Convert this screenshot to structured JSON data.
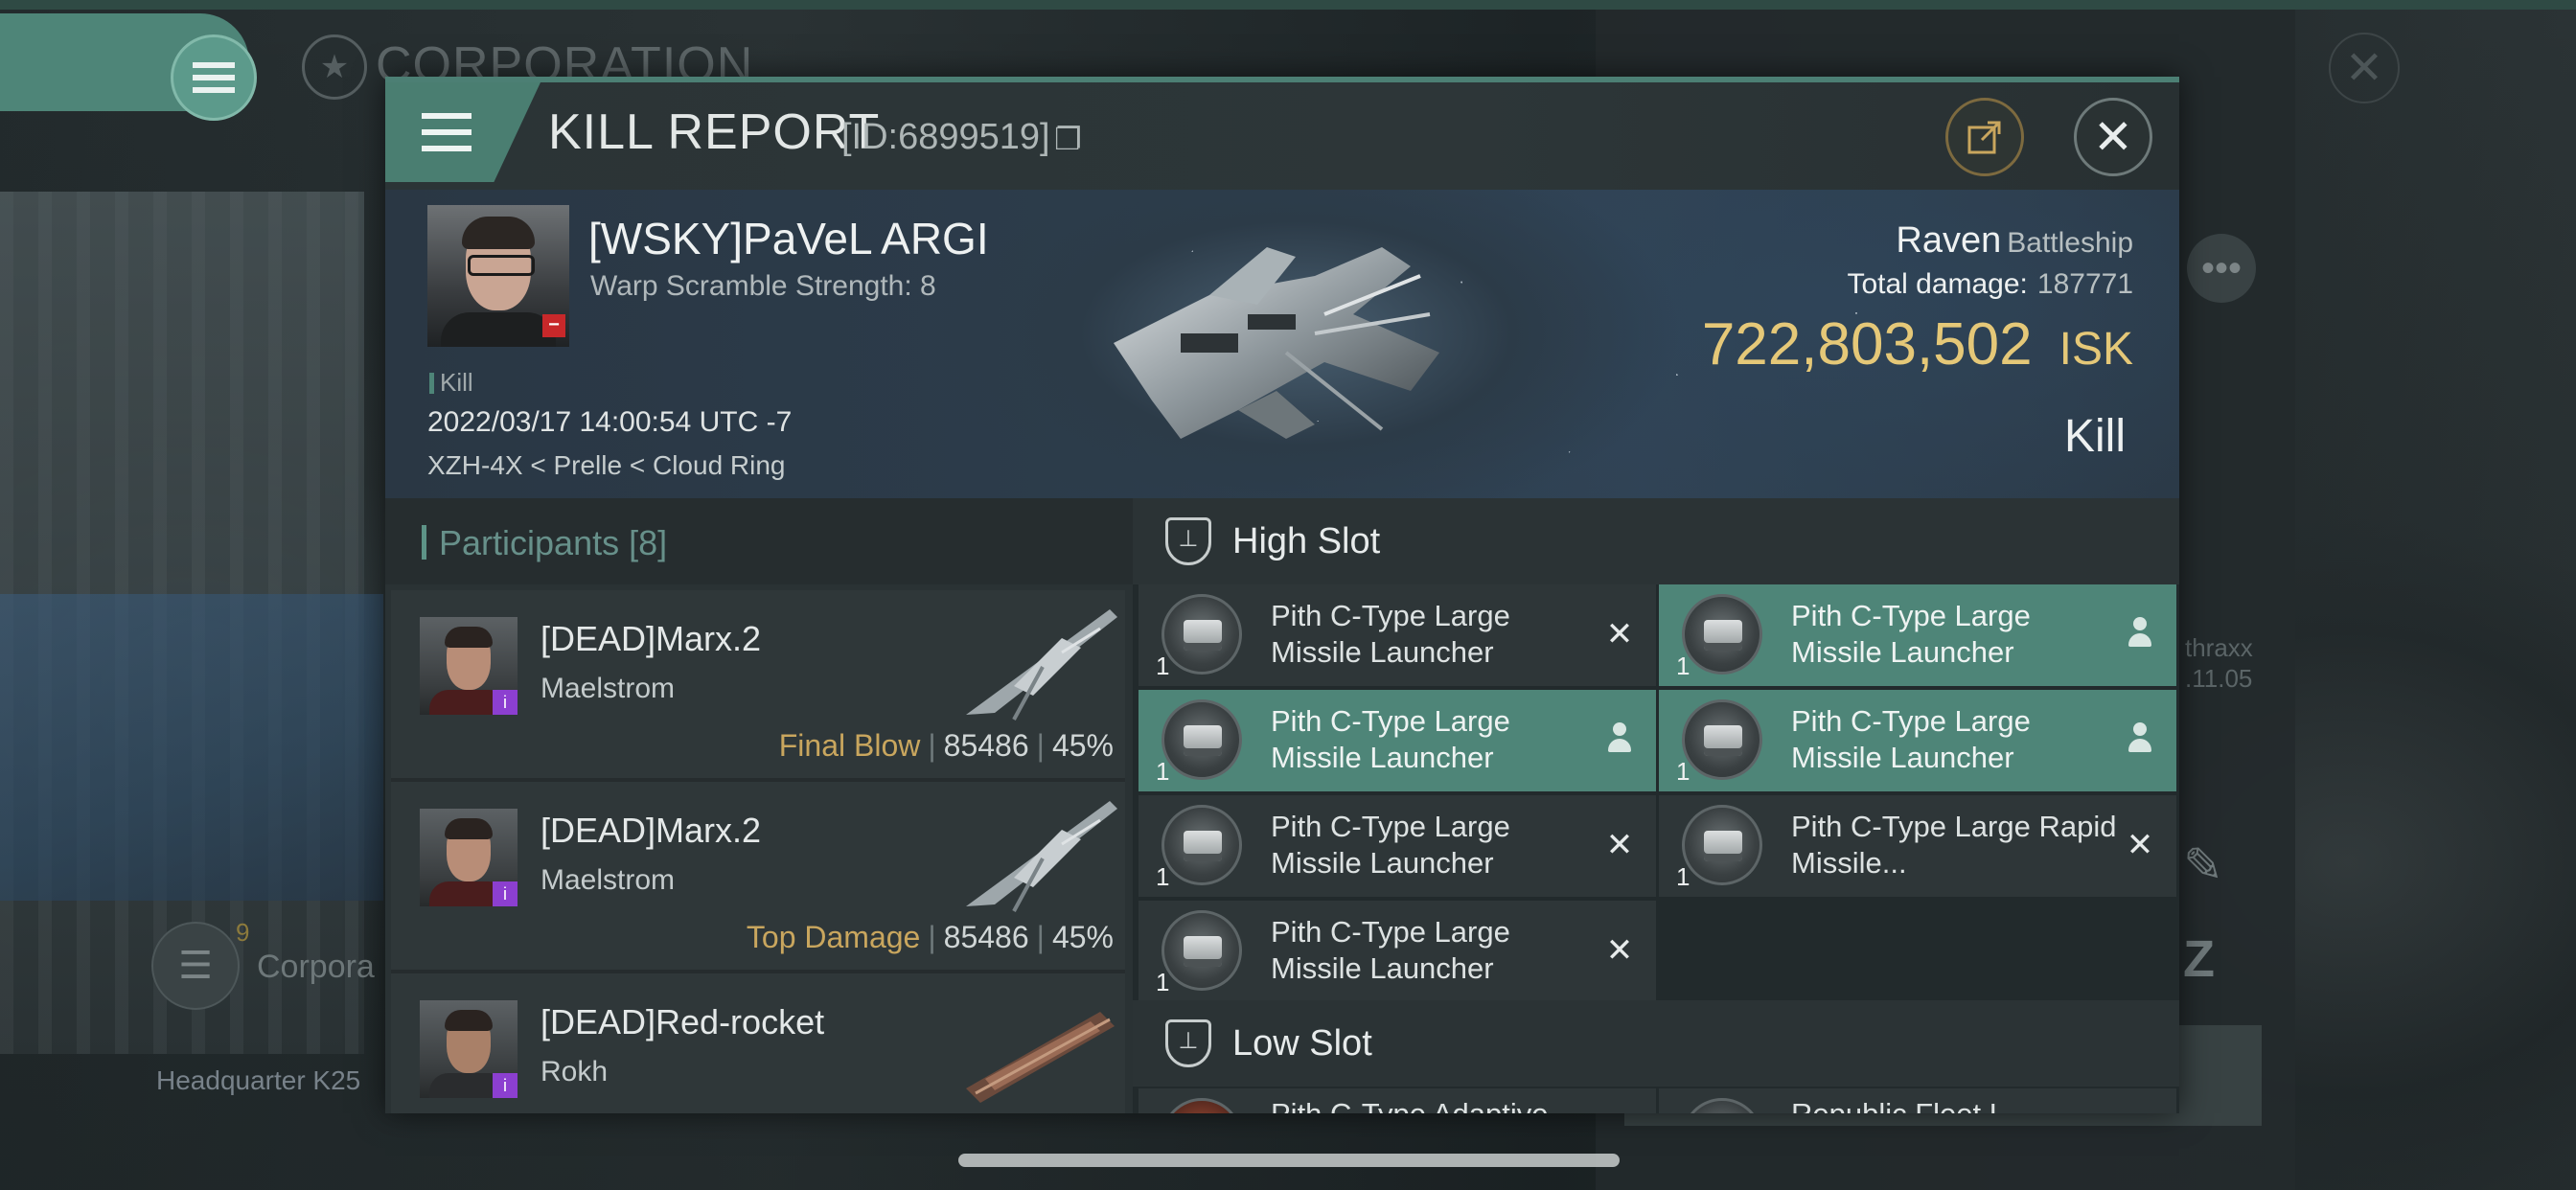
{
  "background": {
    "window_title": "CORPORATION",
    "corporation_label": "Corpora",
    "corporation_badge": "9",
    "headquarter_label": "Headquarter K25",
    "side_text_line1": "thraxx",
    "side_text_line2": ".11.05"
  },
  "dialog": {
    "title": "KILL REPORT",
    "id_label": "[ID:6899519]"
  },
  "victim": {
    "name": "[WSKY]PaVeL ARGI",
    "warp_scramble": "Warp Scramble Strength: 8",
    "tag": "Kill",
    "datetime": "2022/03/17 14:00:54 UTC -7",
    "location": "XZH-4X < Prelle < Cloud Ring",
    "ship_name": "Raven",
    "ship_class": "Battleship",
    "total_damage_label": "Total damage:",
    "total_damage_value": "187771",
    "isk_value": "722,803,502",
    "isk_unit": "ISK",
    "result": "Kill"
  },
  "participants": {
    "title": "Participants",
    "count": "[8]",
    "rows": [
      {
        "name": "[DEAD]Marx.2",
        "ship": "Maelstrom",
        "label": "Final Blow",
        "damage": "85486",
        "percent": "45%"
      },
      {
        "name": "[DEAD]Marx.2",
        "ship": "Maelstrom",
        "label": "Top Damage",
        "damage": "85486",
        "percent": "45%"
      },
      {
        "name": "[DEAD]Red-rocket",
        "ship": "Rokh",
        "label": "",
        "damage": "",
        "percent": ""
      }
    ]
  },
  "fitting": {
    "high_slot_title": "High Slot",
    "low_slot_title": "Low Slot",
    "modules": [
      {
        "qty": "1",
        "name": "Pith C-Type Large Missile Launcher",
        "status": "destroyed"
      },
      {
        "qty": "1",
        "name": "Pith C-Type Large Missile Launcher",
        "status": "dropped"
      },
      {
        "qty": "1",
        "name": "Pith C-Type Large Missile Launcher",
        "status": "dropped"
      },
      {
        "qty": "1",
        "name": "Pith C-Type Large Missile Launcher",
        "status": "dropped"
      },
      {
        "qty": "1",
        "name": "Pith C-Type Large Missile Launcher",
        "status": "destroyed"
      },
      {
        "qty": "1",
        "name": "Pith C-Type Large Rapid Missile...",
        "status": "destroyed"
      },
      {
        "qty": "1",
        "name": "Pith C-Type Large Missile Launcher",
        "status": "destroyed"
      }
    ],
    "low_partial": [
      "Pith C-Type Adaptive",
      "Republic Fleet L"
    ]
  },
  "colors": {
    "accent": "#4e8578",
    "isk_gold": "#e5c878",
    "final_blow_gold": "#c9a65e",
    "standing_red": "#c8282a",
    "badge_purple": "#8c3fd0"
  }
}
